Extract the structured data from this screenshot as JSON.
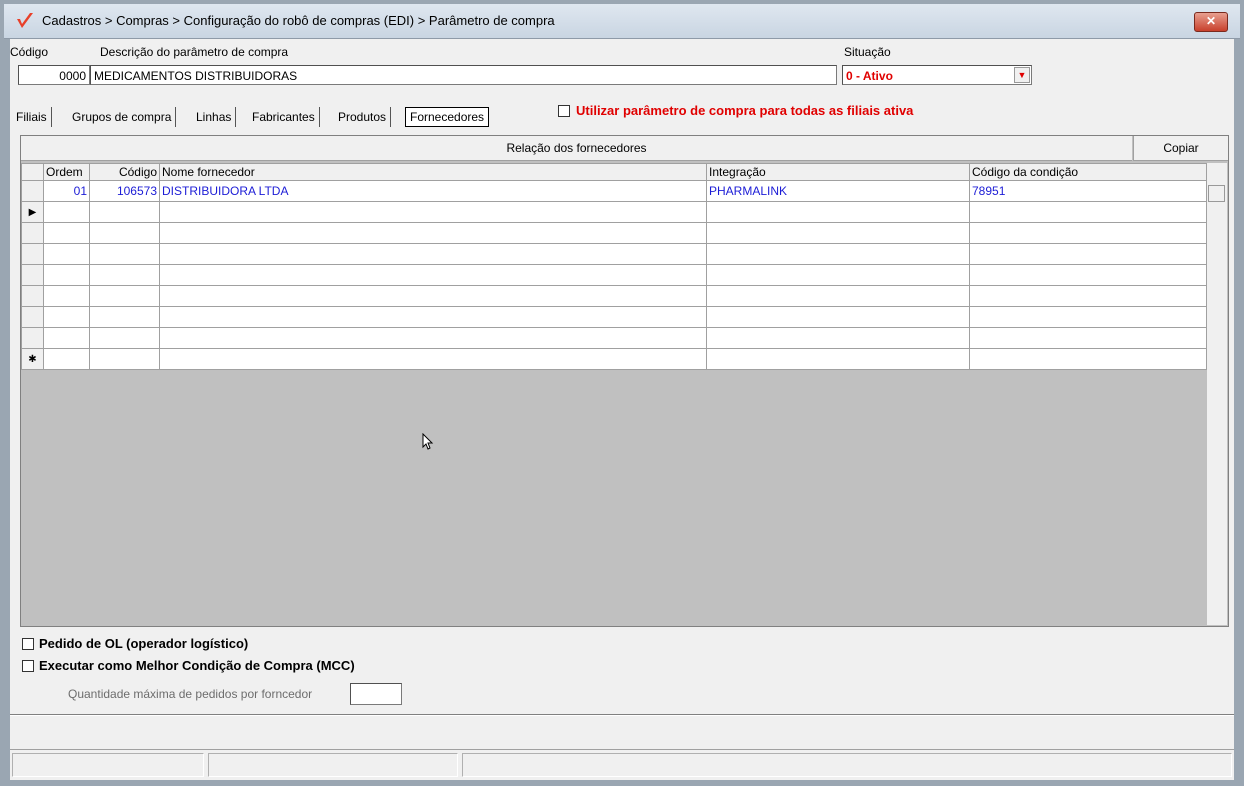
{
  "window": {
    "title": "Cadastros > Compras > Configuração do robô de compras (EDI) > Parâmetro de compra",
    "close_label": "✕"
  },
  "form": {
    "codigo_label": "Código",
    "codigo_value": "0000",
    "descricao_label": "Descrição do parâmetro de compra",
    "descricao_value": "MEDICAMENTOS DISTRIBUIDORAS",
    "situacao_label": "Situação",
    "situacao_value": "0 - Ativo"
  },
  "tabs": [
    {
      "label": "Filiais"
    },
    {
      "label": "Grupos de compra"
    },
    {
      "label": "Linhas"
    },
    {
      "label": "Fabricantes"
    },
    {
      "label": "Produtos"
    },
    {
      "label": "Fornecedores"
    }
  ],
  "all_branches_checkbox_label": "Utilizar parâmetro de compra para todas as filiais ativa",
  "grid": {
    "title": "Relação dos fornecedores",
    "copy_button": "Copiar",
    "columns": [
      "Ordem",
      "Código",
      "Nome fornecedor",
      "Integração",
      "Código da condição"
    ],
    "rows": [
      {
        "ordem": "01",
        "codigo": "106573",
        "nome": "DISTRIBUIDORA  LTDA",
        "integracao": "PHARMALINK",
        "condicao": "78951"
      }
    ],
    "current_row_marker": "▶",
    "new_row_marker": "✱"
  },
  "options": {
    "pedido_ol_label": "Pedido de OL (operador logístico)",
    "mcc_label": "Executar como Melhor Condição de Compra (MCC)",
    "qtd_max_label": "Quantidade máxima de pedidos por forncedor",
    "qtd_max_value": ""
  },
  "colors": {
    "accent_red": "#e00000",
    "link_blue": "#1c1cd6"
  }
}
